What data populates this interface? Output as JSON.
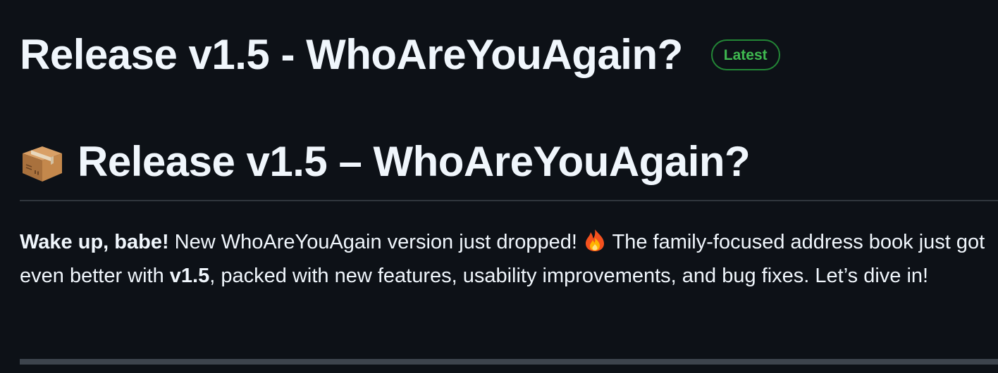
{
  "release": {
    "title": "Release v1.5 - WhoAreYouAgain?",
    "badge": "Latest"
  },
  "notes": {
    "heading_icon": "package-icon",
    "heading": "Release v1.5 – WhoAreYouAgain?",
    "intro": {
      "lead_bold": "Wake up, babe!",
      "text_1": " New WhoAreYouAgain version just dropped! ",
      "emoji_icon": "fire-icon",
      "text_2": " The family-focused address book just got even better with ",
      "version_bold": "v1.5",
      "text_3": ", packed with new features, usability improvements, and bug fixes. Let’s dive in!"
    }
  },
  "colors": {
    "background": "#0d1117",
    "text": "#f0f6fc",
    "badge_text": "#3fb950",
    "badge_border": "#238636",
    "divider": "#30363d"
  }
}
